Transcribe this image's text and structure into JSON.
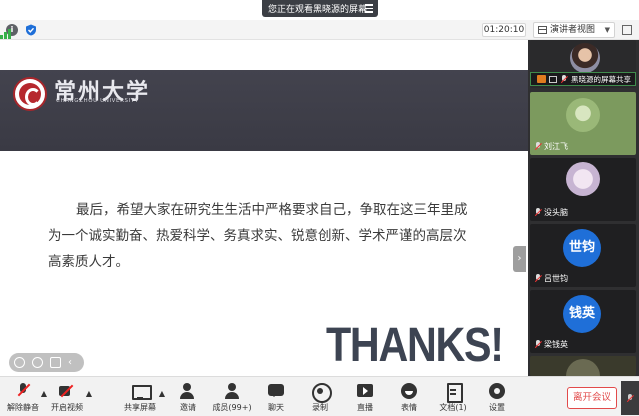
{
  "banner": {
    "text": "您正在观看黑晓源的屏幕"
  },
  "statusbar": {
    "timer": "01:20:10",
    "view_label": "演讲者视图"
  },
  "slide": {
    "university_cn": "常州大学",
    "university_en": "CHANGZHOU UNIVERSITY",
    "body": "最后，希望大家在研究生生活中严格要求自己，争取在这三年里成为一个诚实勤奋、热爱科学、务真求实、锐意创新、学术严谨的高层次高素质人才。",
    "thanks": "THANKS!"
  },
  "participants": {
    "host": {
      "label": "黑晓源的屏幕共享"
    },
    "items": [
      {
        "name": "刘江飞"
      },
      {
        "name": "没头脑"
      },
      {
        "name": "吕世钧",
        "avatar_text": "世钧"
      },
      {
        "name": "梁钱英",
        "avatar_text": "钱英"
      }
    ]
  },
  "toolbar": {
    "mute": "解除静音",
    "video": "开启视频",
    "share": "共享屏幕",
    "invite": "邀请",
    "members": "成员(99+)",
    "chat": "聊天",
    "record": "录制",
    "live": "直播",
    "emoji": "表情",
    "docs": "文档(1)",
    "settings": "设置",
    "leave": "离开会议"
  },
  "colors": {
    "accent_blue": "#1f6fd8",
    "leave_red": "#e24a4a",
    "brand_red": "#b6282e"
  }
}
